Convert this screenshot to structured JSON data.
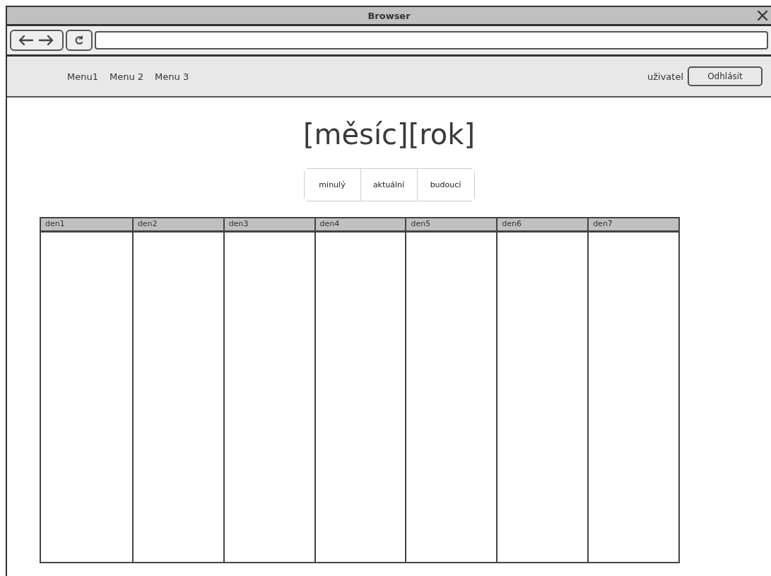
{
  "window": {
    "title": "Browser"
  },
  "nav": {
    "menu_items": [
      "Menu1",
      "Menu 2",
      "Menu 3"
    ],
    "user": "uživatel",
    "logout_button": "Odhlásit"
  },
  "heading": "[měsíc][rok]",
  "period_buttons": [
    "minulý",
    "aktuální",
    "budoucí"
  ],
  "table": {
    "columns": [
      "den1",
      "den2",
      "den3",
      "den4",
      "den5",
      "den6",
      "den7"
    ]
  }
}
